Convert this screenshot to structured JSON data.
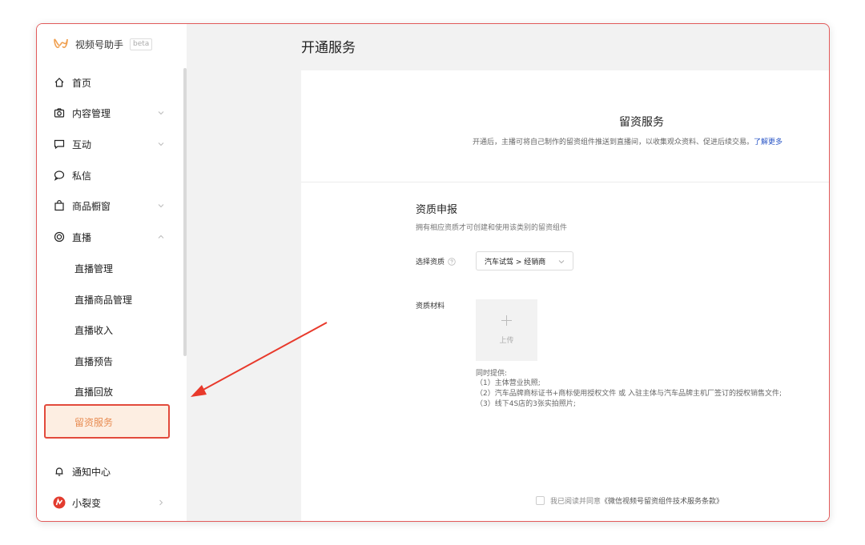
{
  "brand": {
    "name": "视频号助手",
    "badge": "beta"
  },
  "sidebar": {
    "items": [
      {
        "label": "首页",
        "icon": "home-icon"
      },
      {
        "label": "内容管理",
        "icon": "camera-icon"
      },
      {
        "label": "互动",
        "icon": "chat-bubble-icon"
      },
      {
        "label": "私信",
        "icon": "message-icon"
      },
      {
        "label": "商品橱窗",
        "icon": "shopping-bag-icon"
      },
      {
        "label": "直播",
        "icon": "live-icon"
      }
    ],
    "live_sub": [
      "直播管理",
      "直播商品管理",
      "直播收入",
      "直播预告",
      "直播回放",
      "留资服务"
    ],
    "bottom": [
      {
        "label": "通知中心",
        "icon": "bell-icon"
      },
      {
        "label": "小裂变",
        "icon": "app-logo-icon"
      }
    ]
  },
  "header": {
    "title": "开通服务"
  },
  "service": {
    "title": "留资服务",
    "desc": "开通后，主播可将自己制作的留资组件推送到直播间，以收集观众资料、促进后续交易。",
    "learn_more": "了解更多"
  },
  "qualification": {
    "title": "资质申报",
    "desc": "拥有相应资质才可创建和使用该类别的留资组件",
    "select_label": "选择资质",
    "select_value": "汽车试驾 > 经销商",
    "materials_label": "资质材料",
    "upload_label": "上传",
    "provide_lines": [
      "同时提供:",
      "（1）主体营业执照;",
      "（2）汽车品牌商标证书+商标使用授权文件 或 入驻主体与汽车品牌主机厂签订的授权销售文件;",
      "（3）线下4S店的3张实拍照片;"
    ]
  },
  "agreement": {
    "prefix": "我已阅读并同意",
    "link": "《微信视频号留资组件技术服务条款》"
  },
  "colors": {
    "accent": "#e88c52",
    "highlight_border": "#e24a3c",
    "link": "#2a56c6",
    "annotation_arrow": "#e8392b"
  }
}
